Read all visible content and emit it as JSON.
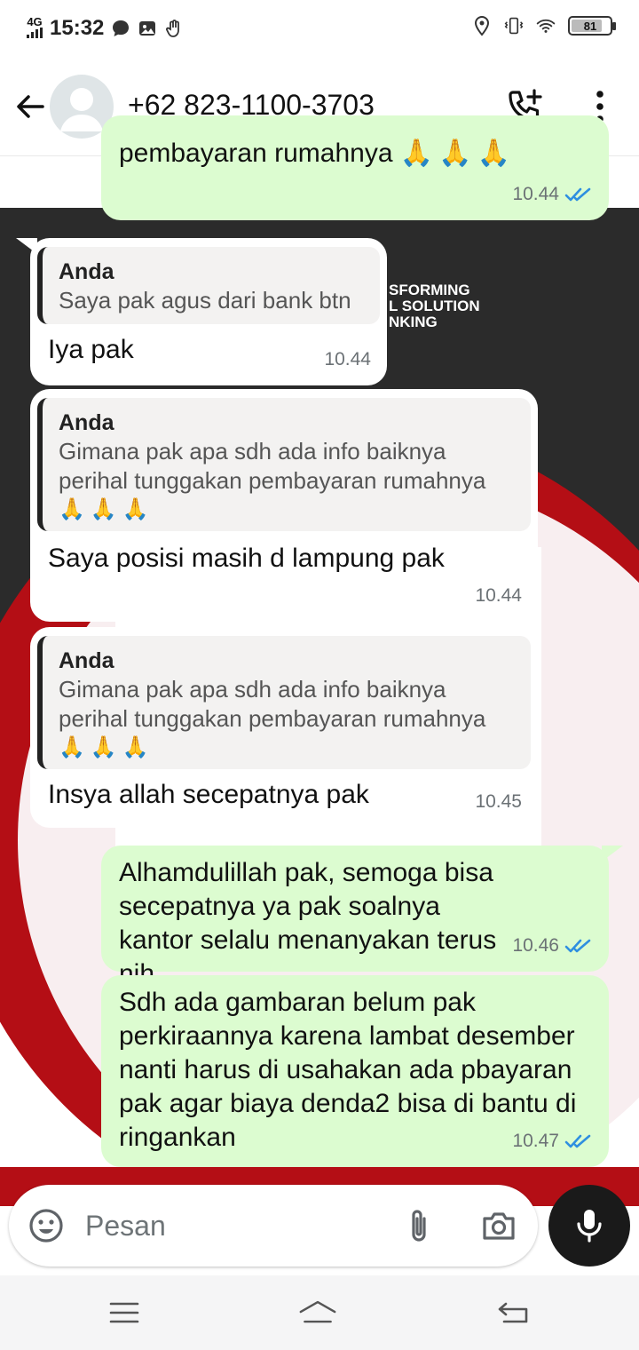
{
  "status_bar": {
    "network": "4G",
    "time": "15:32",
    "battery": "81",
    "battery_level": 0.81
  },
  "header": {
    "contact": "+62 823-1100-3703"
  },
  "wallpaper": {
    "text_lines": [
      "SFORMING",
      "L SOLUTION",
      "NKING"
    ]
  },
  "messages": [
    {
      "direction": "outgoing",
      "partial": true,
      "text": "pembayaran rumahnya",
      "emoji": "🙏🙏🙏",
      "time": "10.44",
      "status": "read"
    },
    {
      "direction": "incoming",
      "quote_author": "Anda",
      "quote_text": "Saya pak agus dari bank btn",
      "text": "Iya pak",
      "time": "10.44"
    },
    {
      "direction": "incoming",
      "quote_author": "Anda",
      "quote_text": "Gimana pak apa sdh ada info baiknya perihal tunggakan pembayaran rumahnya",
      "quote_emoji": "🙏🙏🙏",
      "text": "Saya posisi masih d lampung pak",
      "time": "10.44"
    },
    {
      "direction": "incoming",
      "quote_author": "Anda",
      "quote_text": "Gimana pak apa sdh ada info baiknya perihal tunggakan pembayaran rumahnya",
      "quote_emoji": "🙏🙏🙏",
      "text": "Insya allah secepatnya pak",
      "time": "10.45"
    },
    {
      "direction": "outgoing",
      "text": "Alhamdulillah  pak,  semoga bisa secepatnya ya pak soalnya kantor selalu menanyakan terus nih",
      "time": "10.46",
      "status": "read"
    },
    {
      "direction": "outgoing",
      "text": "Sdh ada gambaran belum pak perkiraannya karena lambat desember nanti harus di usahakan ada pbayaran pak agar biaya denda2 bisa di bantu di ringankan",
      "time": "10.47",
      "status": "read"
    }
  ],
  "composer": {
    "placeholder": "Pesan"
  },
  "colors": {
    "outgoing_bubble": "#dcfcd0",
    "incoming_bubble": "#ffffff",
    "read_ticks": "#2f8fe0",
    "mic_button": "#1a1a1a"
  }
}
